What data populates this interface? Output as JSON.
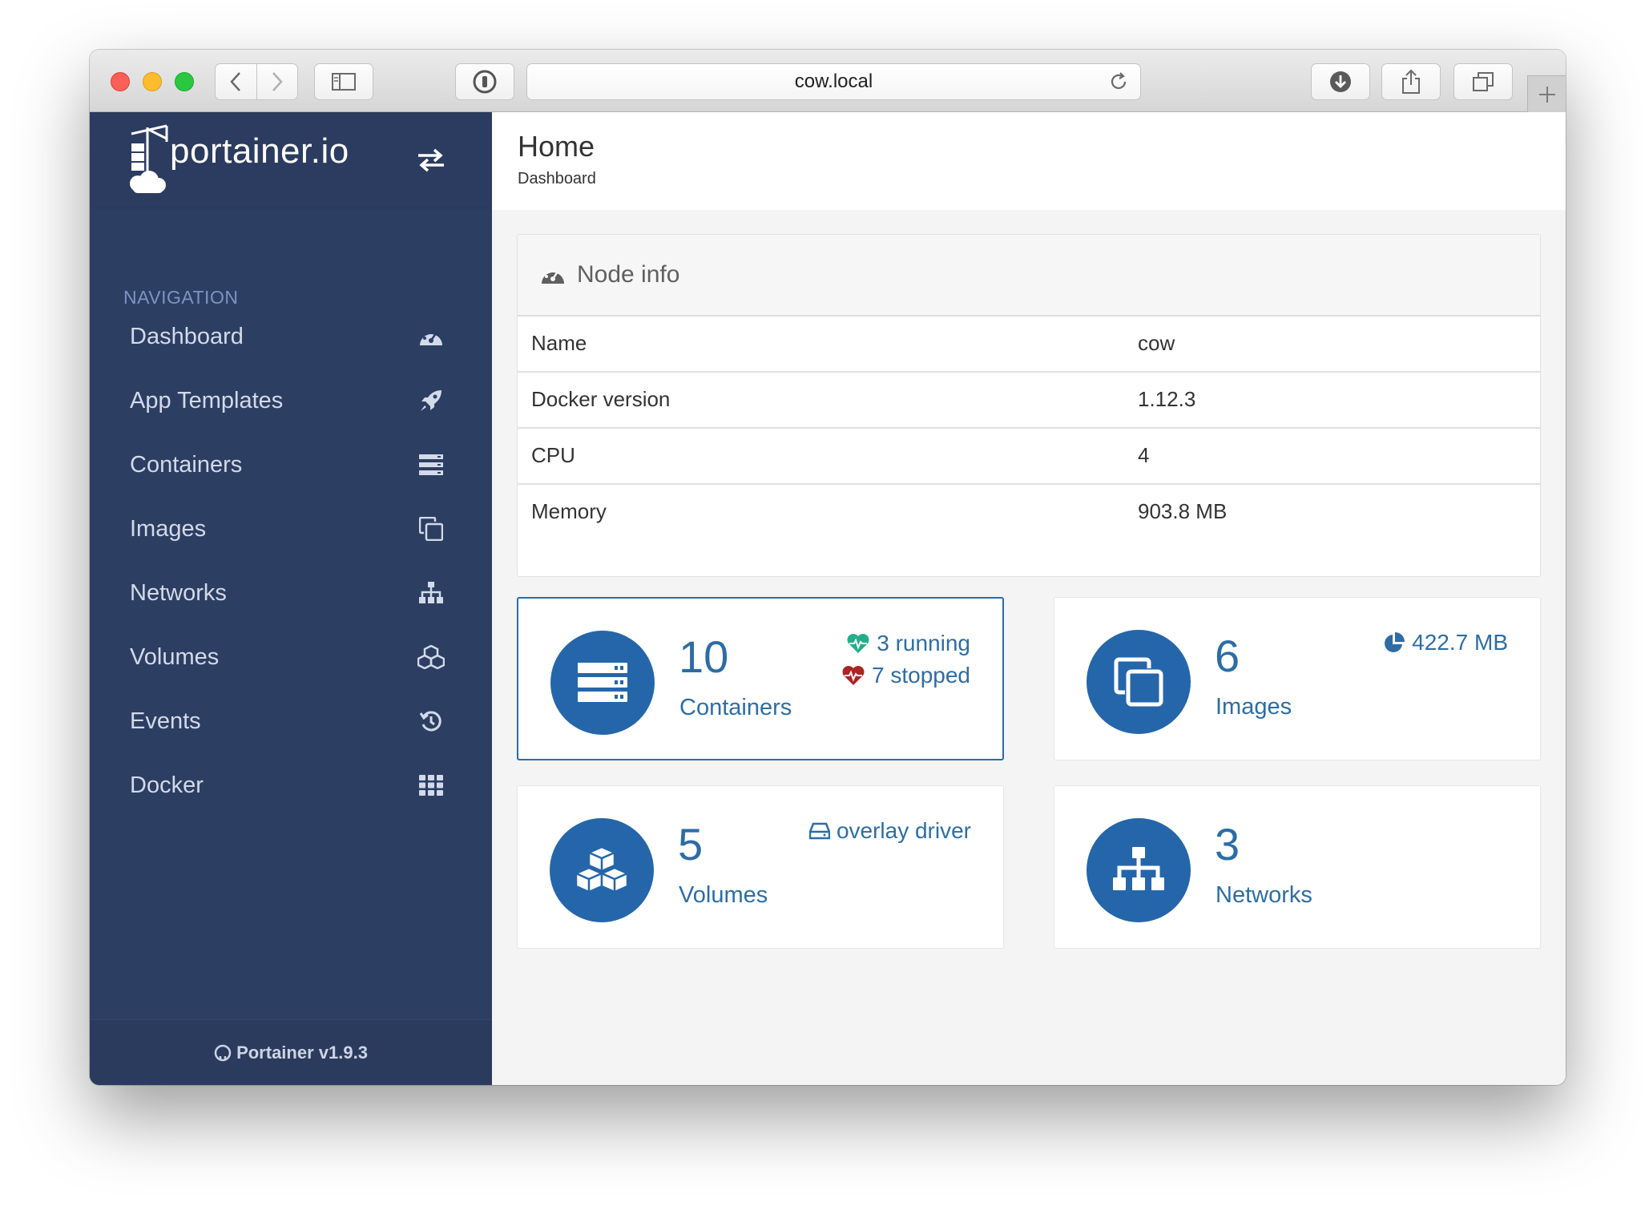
{
  "browser": {
    "url": "cow.local"
  },
  "sidebar": {
    "brand": "portainer.io",
    "section_title": "NAVIGATION",
    "items": [
      {
        "label": "Dashboard",
        "icon": "dashboard-icon"
      },
      {
        "label": "App Templates",
        "icon": "rocket-icon"
      },
      {
        "label": "Containers",
        "icon": "server-icon"
      },
      {
        "label": "Images",
        "icon": "clone-icon"
      },
      {
        "label": "Networks",
        "icon": "sitemap-icon"
      },
      {
        "label": "Volumes",
        "icon": "cubes-icon"
      },
      {
        "label": "Events",
        "icon": "history-icon"
      },
      {
        "label": "Docker",
        "icon": "grid-icon"
      }
    ],
    "footer": "Portainer v1.9.3"
  },
  "header": {
    "title": "Home",
    "subtitle": "Dashboard"
  },
  "node_info": {
    "title": "Node info",
    "rows": [
      {
        "key": "Name",
        "value": "cow"
      },
      {
        "key": "Docker version",
        "value": "1.12.3"
      },
      {
        "key": "CPU",
        "value": "4"
      },
      {
        "key": "Memory",
        "value": "903.8 MB"
      }
    ]
  },
  "widgets": {
    "containers": {
      "count": "10",
      "label": "Containers",
      "running": "3 running",
      "stopped": "7 stopped"
    },
    "images": {
      "count": "6",
      "label": "Images",
      "size": "422.7 MB"
    },
    "volumes": {
      "count": "5",
      "label": "Volumes",
      "driver": "overlay driver"
    },
    "networks": {
      "count": "3",
      "label": "Networks"
    }
  },
  "colors": {
    "sidebar": "#2d3e63",
    "accent": "#2566ab",
    "running": "#23ae89",
    "stopped": "#ae2323"
  }
}
